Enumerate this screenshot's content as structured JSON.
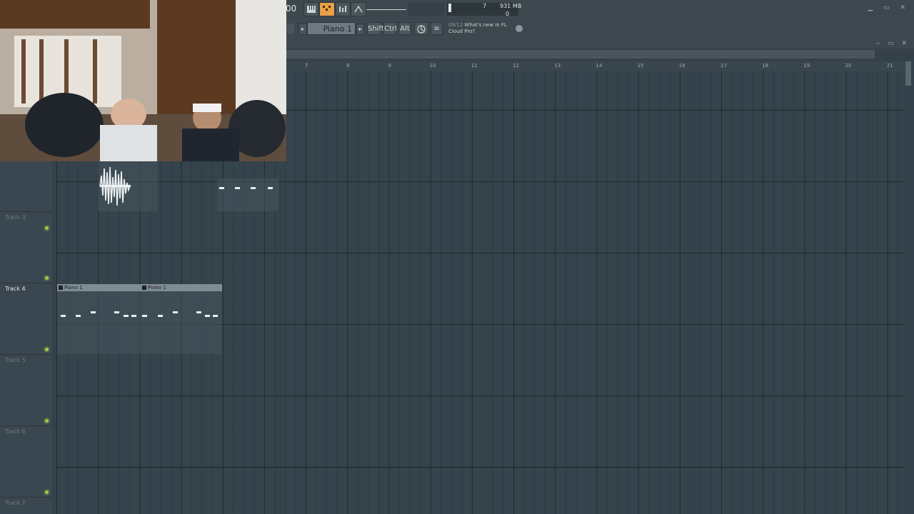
{
  "toolbar": {
    "pattern_name": "Piano 1",
    "modifier_keys": [
      "Shift",
      "Ctrl",
      "Alt"
    ],
    "cpu_memory": "931 MB",
    "polyphony": "7",
    "zero_value": "0",
    "news_date": "09/12",
    "news_text": "What's new in FL Cloud Pro?",
    "tempo_fragment": "00",
    "tool_buttons": [
      "piano-roll-icon",
      "step-seq-icon",
      "mixer-icon",
      "plugin-icon"
    ]
  },
  "ruler": {
    "bars": [
      "7",
      "8",
      "9",
      "10",
      "11",
      "12",
      "13",
      "14",
      "15",
      "16",
      "17",
      "18",
      "19",
      "20",
      "21"
    ]
  },
  "tracks": [
    {
      "name": "Track 3",
      "highlight": false
    },
    {
      "name": "Track 4",
      "highlight": true
    },
    {
      "name": "Track 5",
      "highlight": false
    },
    {
      "name": "Track 6",
      "highlight": false
    },
    {
      "name": "Track 7",
      "highlight": false
    }
  ],
  "clips": [
    {
      "label": "Piano 1"
    },
    {
      "label": "Piano 1"
    }
  ],
  "colors": {
    "accent_orange": "#e8a048",
    "track_led_green": "#9ec842",
    "playlist_bg": "#35434c"
  }
}
